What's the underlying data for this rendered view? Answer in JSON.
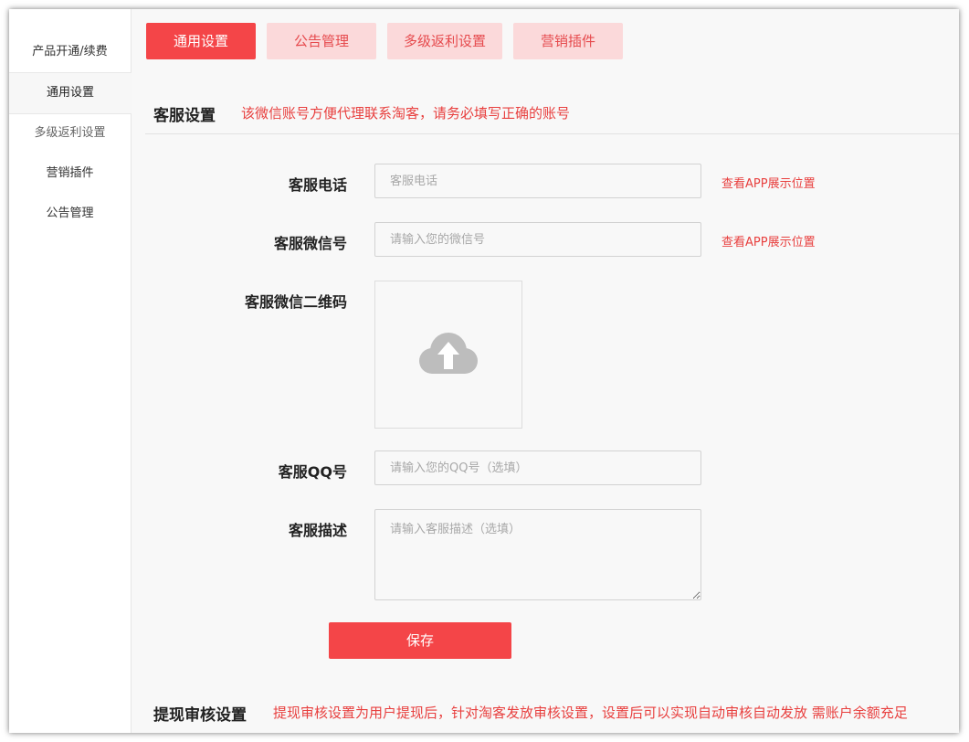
{
  "sidebar": {
    "items": [
      {
        "label": "产品开通/续费"
      },
      {
        "label": "通用设置"
      },
      {
        "label": "多级返利设置"
      },
      {
        "label": "营销插件"
      },
      {
        "label": "公告管理"
      }
    ]
  },
  "tabs": [
    {
      "label": "通用设置",
      "active": true
    },
    {
      "label": "公告管理",
      "active": false
    },
    {
      "label": "多级返利设置",
      "active": false
    },
    {
      "label": "营销插件",
      "active": false
    }
  ],
  "customer_service": {
    "title": "客服设置",
    "note": "该微信账号方便代理联系淘客，请务必填写正确的账号",
    "phone": {
      "label": "客服电话",
      "value": "",
      "placeholder": "客服电话",
      "link": "查看APP展示位置"
    },
    "wechat": {
      "label": "客服微信号",
      "value": "",
      "placeholder": "请输入您的微信号",
      "link": "查看APP展示位置"
    },
    "qrcode": {
      "label": "客服微信二维码",
      "icon": "cloud-upload-icon"
    },
    "qq": {
      "label": "客服QQ号",
      "value": "",
      "placeholder": "请输入您的QQ号（选填）"
    },
    "description": {
      "label": "客服描述",
      "value": "",
      "placeholder": "请输入客服描述（选填）"
    },
    "save_label": "保存"
  },
  "withdraw_review": {
    "title": "提现审核设置",
    "note": "提现审核设置为用户提现后，针对淘客发放审核设置，设置后可以实现自动审核自动发放 需账户余额充足"
  },
  "colors": {
    "accent": "#f44548",
    "accent_light": "#fbd9da",
    "note_red": "#e8403f"
  }
}
